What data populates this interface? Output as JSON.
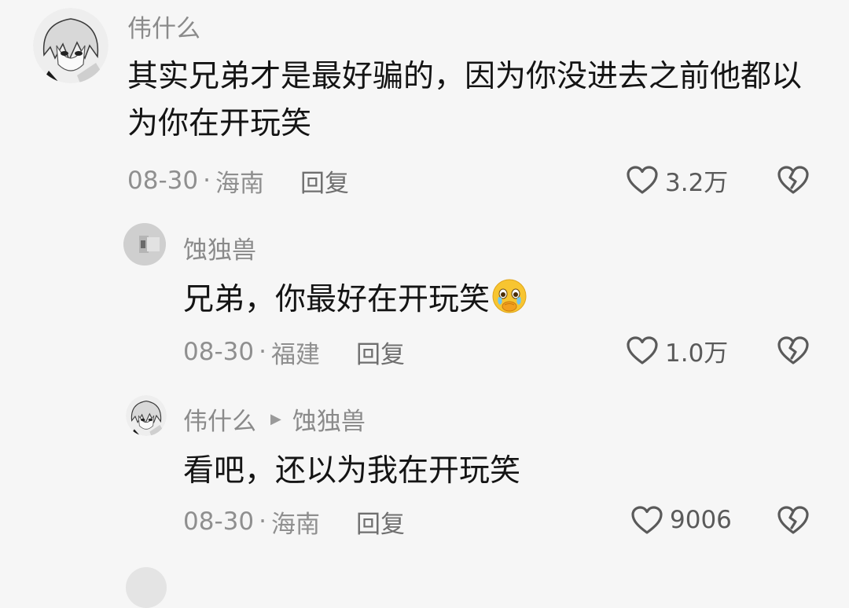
{
  "comments": [
    {
      "user": "伟什么",
      "text": "其实兄弟才是最好骗的，因为你没进去之前他都以为你在开玩笑",
      "date": "08-30",
      "separator": "·",
      "location": "海南",
      "reply_label": "回复",
      "likes": "3.2万"
    },
    {
      "user": "蚀独兽",
      "text": "兄弟，你最好在开玩笑",
      "date": "08-30",
      "separator": "·",
      "location": "福建",
      "reply_label": "回复",
      "likes": "1.0万",
      "emoji": "crying-face-emoji"
    },
    {
      "user": "伟什么",
      "reply_to": "蚀独兽",
      "text": "看吧，还以为我在开玩笑",
      "date": "08-30",
      "separator": "·",
      "location": "海南",
      "reply_label": "回复",
      "likes": "9006"
    }
  ],
  "icons": {
    "like": "heart-outline-icon",
    "dislike": "broken-heart-icon",
    "reply_arrow": "triangle-right-icon"
  },
  "colors": {
    "background": "#f6f6f6",
    "text": "#141414",
    "meta": "#8f8f8f"
  }
}
